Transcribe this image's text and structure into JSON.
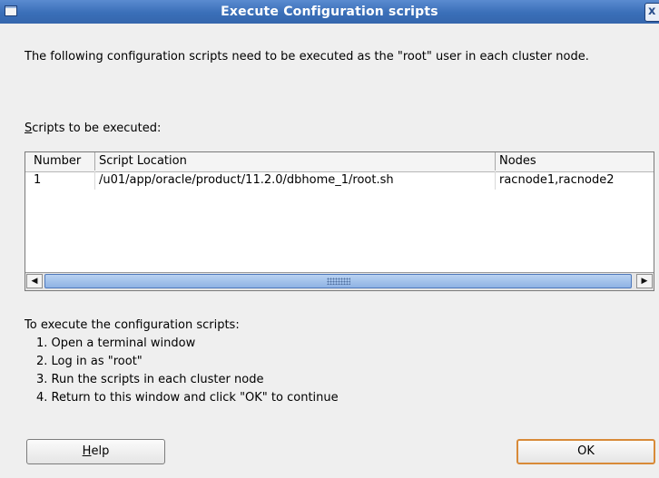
{
  "window": {
    "title": "Execute Configuration scripts",
    "close_glyph": "x"
  },
  "intro": {
    "text": "The following configuration scripts need to be executed as the \"root\" user in each cluster node."
  },
  "scripts_label": {
    "mnemonic": "S",
    "rest": "cripts to be executed:"
  },
  "table": {
    "columns": [
      "Number",
      "Script Location",
      "Nodes"
    ],
    "rows": [
      [
        "1",
        "/u01/app/oracle/product/11.2.0/dbhome_1/root.sh",
        "racnode1,racnode2"
      ]
    ]
  },
  "instructions": {
    "heading": "To execute the configuration scripts:",
    "steps": [
      "1. Open a terminal window",
      "2. Log in as \"root\"",
      "3. Run the scripts in each cluster node",
      "4. Return to this window and click \"OK\" to continue"
    ]
  },
  "buttons": {
    "help_mnemonic": "H",
    "help_rest": "elp",
    "ok": "OK"
  }
}
